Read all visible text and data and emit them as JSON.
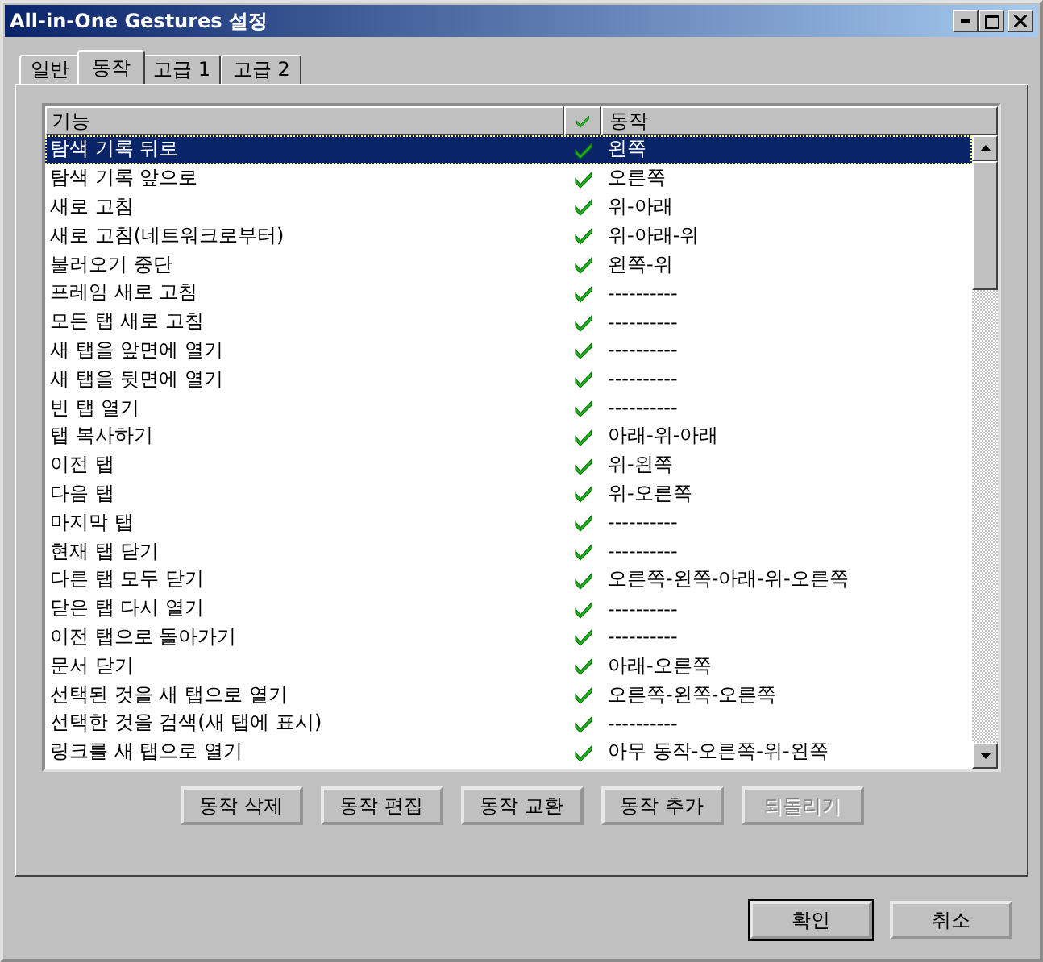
{
  "window": {
    "title": "All-in-One Gestures 설정"
  },
  "tabs": [
    {
      "label": "일반",
      "selected": false
    },
    {
      "label": "동작",
      "selected": true
    },
    {
      "label": "고급 1",
      "selected": false
    },
    {
      "label": "고급 2",
      "selected": false
    }
  ],
  "table": {
    "columns": [
      "기능",
      "동작"
    ],
    "rows": [
      {
        "function": "탐색 기록 뒤로",
        "checked": true,
        "gesture": "왼쪽",
        "selected": true
      },
      {
        "function": "탐색 기록 앞으로",
        "checked": true,
        "gesture": "오른쪽",
        "selected": false
      },
      {
        "function": "새로 고침",
        "checked": true,
        "gesture": "위-아래",
        "selected": false
      },
      {
        "function": "새로 고침(네트워크로부터)",
        "checked": true,
        "gesture": "위-아래-위",
        "selected": false
      },
      {
        "function": "불러오기 중단",
        "checked": true,
        "gesture": "왼쪽-위",
        "selected": false
      },
      {
        "function": "프레임 새로 고침",
        "checked": true,
        "gesture": "----------",
        "selected": false
      },
      {
        "function": "모든 탭 새로 고침",
        "checked": true,
        "gesture": "----------",
        "selected": false
      },
      {
        "function": "새 탭을 앞면에 열기",
        "checked": true,
        "gesture": "----------",
        "selected": false
      },
      {
        "function": "새 탭을 뒷면에 열기",
        "checked": true,
        "gesture": "----------",
        "selected": false
      },
      {
        "function": "빈 탭 열기",
        "checked": true,
        "gesture": "----------",
        "selected": false
      },
      {
        "function": "탭 복사하기",
        "checked": true,
        "gesture": "아래-위-아래",
        "selected": false
      },
      {
        "function": "이전 탭",
        "checked": true,
        "gesture": "위-왼쪽",
        "selected": false
      },
      {
        "function": "다음 탭",
        "checked": true,
        "gesture": "위-오른쪽",
        "selected": false
      },
      {
        "function": "마지막 탭",
        "checked": true,
        "gesture": "----------",
        "selected": false
      },
      {
        "function": "현재 탭 닫기",
        "checked": true,
        "gesture": "----------",
        "selected": false
      },
      {
        "function": "다른 탭 모두 닫기",
        "checked": true,
        "gesture": "오른쪽-왼쪽-아래-위-오른쪽",
        "selected": false
      },
      {
        "function": "닫은 탭 다시 열기",
        "checked": true,
        "gesture": "----------",
        "selected": false
      },
      {
        "function": "이전 탭으로 돌아가기",
        "checked": true,
        "gesture": "----------",
        "selected": false
      },
      {
        "function": "문서 닫기",
        "checked": true,
        "gesture": "아래-오른쪽",
        "selected": false
      },
      {
        "function": "선택된 것을 새 탭으로 열기",
        "checked": true,
        "gesture": "오른쪽-왼쪽-오른쪽",
        "selected": false
      },
      {
        "function": "선택한 것을 검색(새 탭에 표시)",
        "checked": true,
        "gesture": "----------",
        "selected": false
      },
      {
        "function": "링크를 새 탭으로 열기",
        "checked": true,
        "gesture": "아무 동작-오른쪽-위-왼쪽",
        "selected": false
      }
    ]
  },
  "action_buttons": [
    {
      "label": "동작 삭제",
      "disabled": false
    },
    {
      "label": "동작 편집",
      "disabled": false
    },
    {
      "label": "동작 교환",
      "disabled": false
    },
    {
      "label": "동작 추가",
      "disabled": false
    },
    {
      "label": "되돌리기",
      "disabled": true
    }
  ],
  "dialog_buttons": [
    {
      "label": "확인",
      "default": true
    },
    {
      "label": "취소",
      "default": false
    }
  ]
}
